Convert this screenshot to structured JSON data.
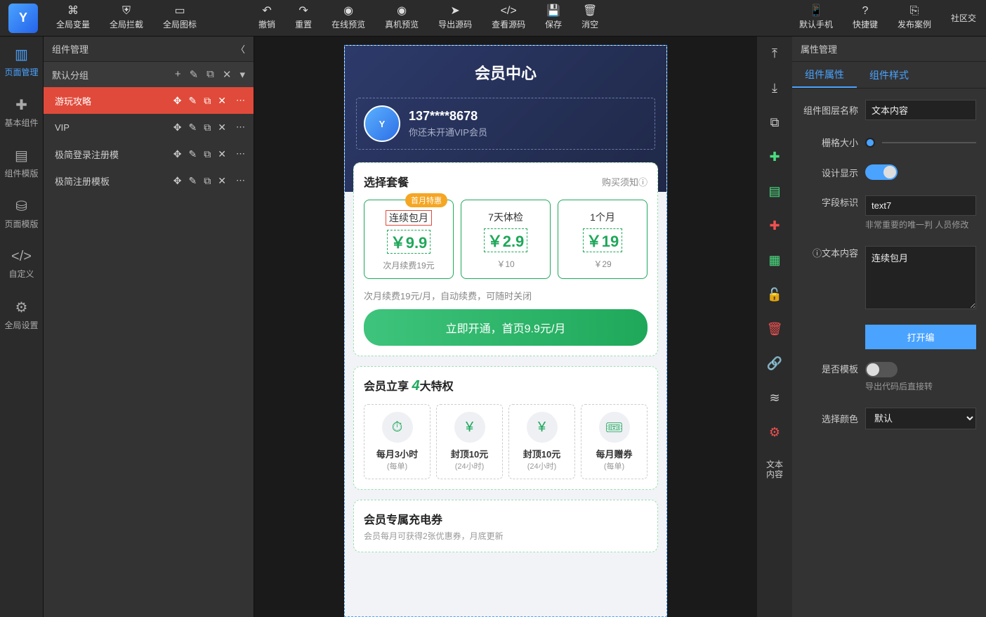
{
  "toolbar": {
    "global_var": "全局变量",
    "global_block": "全局拦截",
    "global_icon": "全局图标",
    "undo": "撤销",
    "reset": "重置",
    "preview_online": "在线预览",
    "preview_device": "真机预览",
    "export_src": "导出源码",
    "view_src": "查看源码",
    "save": "保存",
    "clear": "消空",
    "default_phone": "默认手机",
    "shortcut": "快捷键",
    "publish": "发布案例",
    "community": "社区交"
  },
  "leftbar": {
    "page_manage": "页面管理",
    "basic_comp": "基本组件",
    "comp_template": "组件模版",
    "page_template": "页面模版",
    "custom": "自定义",
    "global_setting": "全局设置"
  },
  "panel": {
    "title": "组件管理",
    "group": "默认分组",
    "items": [
      "游玩攻略",
      "VIP",
      "极简登录注册模",
      "极简注册模板"
    ]
  },
  "phone": {
    "title": "会员中心",
    "phone_num": "137****8678",
    "vip_status": "你还未开通VIP会员",
    "select_plan": "选择套餐",
    "buy_notice": "购买须知ⓘ",
    "plans": [
      {
        "badge": "首月特惠",
        "name": "连续包月",
        "price": "￥9.9",
        "sub": "次月续费19元"
      },
      {
        "badge": "",
        "name": "7天体检",
        "price": "￥2.9",
        "sub": "￥10"
      },
      {
        "badge": "",
        "name": "1个月",
        "price": "￥19",
        "sub": "￥29"
      }
    ],
    "renew_note": "次月续费19元/月，自动续费，可随时关闭",
    "open_btn": "立即开通，首页9.9元/月",
    "priv_title_1": "会员立享",
    "priv_num": "4",
    "priv_title_2": "大特权",
    "privs": [
      {
        "t1": "每月3小时",
        "t2": "(每单)"
      },
      {
        "t1": "封顶10元",
        "t2": "(24小时)"
      },
      {
        "t1": "封顶10元",
        "t2": "(24小时)"
      },
      {
        "t1": "每月赠券",
        "t2": "(每单)"
      }
    ],
    "coupon_title": "会员专属充电券",
    "coupon_sub": "会员每月可获得2张优惠券，月底更新"
  },
  "prop": {
    "title": "属性管理",
    "tab1": "组件属性",
    "tab2": "组件样式",
    "layer_name_lab": "组件图层名称",
    "layer_name_val": "文本内容",
    "grid_size_lab": "栅格大小",
    "design_show_lab": "设计显示",
    "field_id_lab": "字段标识",
    "field_id_val": "text7",
    "field_id_desc": "非常重要的唯一判\n人员修改",
    "text_content_lab": "ⓘ文本内容",
    "text_content_val": "连续包月",
    "open_edit": "打开编",
    "is_template_lab": "是否模板",
    "is_template_desc": "导出代码后直接转",
    "select_color_lab": "选择颜色",
    "select_color_val": "默认"
  }
}
